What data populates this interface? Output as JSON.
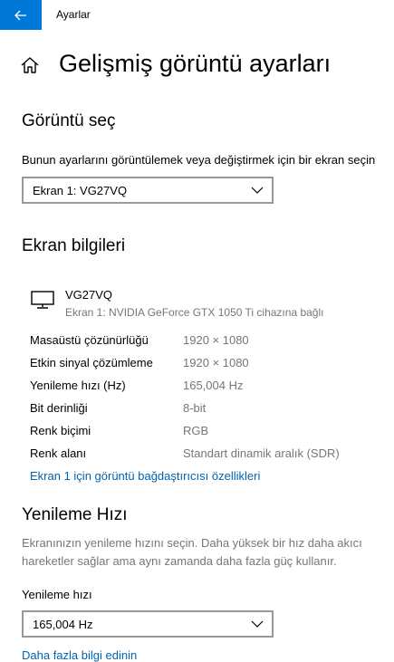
{
  "window": {
    "title": "Ayarlar"
  },
  "page": {
    "title": "Gelişmiş görüntü ayarları"
  },
  "select_display": {
    "heading": "Görüntü seç",
    "instruction": "Bunun ayarlarını görüntülemek veya değiştirmek için bir ekran seçin",
    "selected": "Ekran 1: VG27VQ"
  },
  "display_info": {
    "heading": "Ekran bilgileri",
    "monitor_name": "VG27VQ",
    "monitor_sub": "Ekran 1: NVIDIA GeForce GTX 1050 Ti cihazına bağlı",
    "rows": [
      {
        "label": "Masaüstü çözünürlüğü",
        "value": "1920 × 1080"
      },
      {
        "label": "Etkin sinyal çözümleme",
        "value": "1920 × 1080"
      },
      {
        "label": "Yenileme hızı (Hz)",
        "value": "165,004 Hz"
      },
      {
        "label": "Bit derinliği",
        "value": "8-bit"
      },
      {
        "label": "Renk biçimi",
        "value": "RGB"
      },
      {
        "label": "Renk alanı",
        "value": "Standart dinamik aralık (SDR)"
      }
    ],
    "adapter_link": "Ekran 1 için görüntü bağdaştırıcısı özellikleri"
  },
  "refresh_rate": {
    "heading": "Yenileme Hızı",
    "description_line1": "Ekranınızın yenileme hızını seçin. Daha yüksek bir hız daha akıcı",
    "description_line2": "hareketler sağlar ama aynı zamanda daha fazla güç kullanır.",
    "label": "Yenileme hızı",
    "selected": "165,004 Hz",
    "more_link": "Daha fazla bilgi edinin"
  },
  "colors": {
    "accent": "#0078d7",
    "link": "#0063b1",
    "secondary_text": "#767676"
  },
  "icons": {
    "back": "back-arrow-icon",
    "home": "home-icon",
    "monitor": "monitor-icon",
    "chevron": "chevron-down-icon"
  }
}
